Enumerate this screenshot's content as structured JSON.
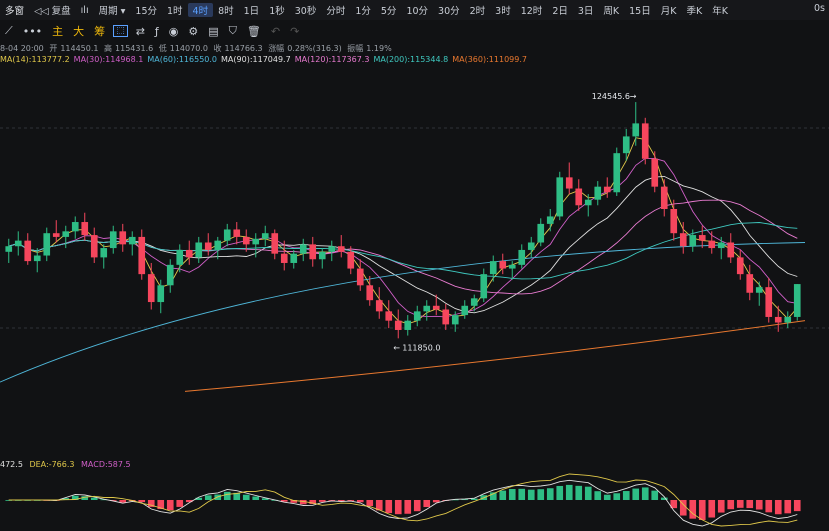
{
  "toolbar": {
    "left": "多窗",
    "replay": "复盘",
    "period": "周期",
    "items": [
      "15分",
      "1时",
      "4时",
      "8时",
      "1日",
      "1秒",
      "30秒",
      "分时",
      "1分",
      "5分",
      "10分",
      "30分",
      "2时",
      "3时",
      "12时",
      "2日",
      "3日",
      "周K",
      "15日",
      "月K",
      "季K",
      "年K"
    ],
    "active_index": 2,
    "right": "0s"
  },
  "drawbar": {
    "indicators": [
      "主",
      "大",
      "筹"
    ]
  },
  "ohlc": {
    "date": "8-04 20:00",
    "open_label": "开",
    "open": "114450.1",
    "high_label": "高",
    "high": "115431.6",
    "low_label": "低",
    "low": "114070.0",
    "close_label": "收",
    "close": "114766.3",
    "change_label": "涨幅",
    "change": "0.28%(316.3)",
    "amp_label": "振幅",
    "amp": "1.19%"
  },
  "ma": [
    {
      "label": "7",
      "value": "MA(14):113777.2",
      "color": "#e0c84a"
    },
    {
      "label": "ma30",
      "value": "MA(30):114968.1",
      "color": "#d05fc8"
    },
    {
      "label": "ma60",
      "value": "MA(60):116550.0",
      "color": "#4fb6d8"
    },
    {
      "label": "ma90",
      "value": "MA(90):117049.7",
      "color": "#e0e0e0"
    },
    {
      "label": "ma120",
      "value": "MA(120):117367.3",
      "color": "#e87bd0"
    },
    {
      "label": "ma200",
      "value": "MA(200):115344.8",
      "color": "#3fc9c0"
    },
    {
      "label": "ma360",
      "value": "MA(360):111099.7",
      "color": "#e8782f"
    }
  ],
  "macd": {
    "dif": "472.5",
    "dea": "DEA:-766.3",
    "macd": "MACD:587.5",
    "dif_color": "#e0e0e0",
    "dea_color": "#e0c84a",
    "macd_color": "#d05fc8"
  },
  "chart_data": {
    "type": "candlestick",
    "annotations": [
      {
        "text": "124545.6",
        "kind": "high"
      },
      {
        "text": "111850.0",
        "kind": "low"
      }
    ],
    "price_range": [
      108000,
      126000
    ],
    "candles": [
      [
        116500,
        117200,
        115900,
        116800
      ],
      [
        116800,
        117600,
        116300,
        117100
      ],
      [
        117100,
        117500,
        115800,
        116000
      ],
      [
        116000,
        116700,
        115400,
        116300
      ],
      [
        116300,
        117800,
        116000,
        117500
      ],
      [
        117500,
        118200,
        117000,
        117300
      ],
      [
        117300,
        117900,
        116700,
        117600
      ],
      [
        117600,
        118400,
        117200,
        118100
      ],
      [
        118100,
        118600,
        117100,
        117400
      ],
      [
        117400,
        117800,
        115900,
        116200
      ],
      [
        116200,
        116900,
        115600,
        116700
      ],
      [
        116700,
        117900,
        116400,
        117600
      ],
      [
        117600,
        118000,
        116500,
        116900
      ],
      [
        116900,
        117600,
        116300,
        117300
      ],
      [
        117300,
        117700,
        115000,
        115300
      ],
      [
        115300,
        115900,
        113400,
        113800
      ],
      [
        113800,
        115000,
        113200,
        114700
      ],
      [
        114700,
        116100,
        114300,
        115800
      ],
      [
        115800,
        116900,
        115400,
        116600
      ],
      [
        116600,
        117100,
        115800,
        116200
      ],
      [
        116200,
        117300,
        115900,
        117000
      ],
      [
        117000,
        117500,
        116300,
        116600
      ],
      [
        116600,
        117300,
        116100,
        117100
      ],
      [
        117100,
        118000,
        116800,
        117700
      ],
      [
        117700,
        118100,
        116900,
        117300
      ],
      [
        117300,
        117700,
        116500,
        116900
      ],
      [
        116900,
        117500,
        116200,
        117200
      ],
      [
        117200,
        117900,
        116800,
        117500
      ],
      [
        117500,
        117700,
        116100,
        116400
      ],
      [
        116400,
        117100,
        115500,
        115900
      ],
      [
        115900,
        116600,
        115600,
        116400
      ],
      [
        116400,
        117200,
        116000,
        116900
      ],
      [
        116900,
        117300,
        115700,
        116100
      ],
      [
        116100,
        116700,
        115600,
        116500
      ],
      [
        116500,
        117100,
        116000,
        116800
      ],
      [
        116800,
        117400,
        116200,
        116500
      ],
      [
        116500,
        116800,
        115300,
        115600
      ],
      [
        115600,
        116100,
        114400,
        114700
      ],
      [
        114700,
        115200,
        113600,
        113900
      ],
      [
        113900,
        114600,
        112900,
        113300
      ],
      [
        113300,
        113900,
        112400,
        112800
      ],
      [
        112800,
        113400,
        111850,
        112300
      ],
      [
        112300,
        113100,
        112000,
        112800
      ],
      [
        112800,
        113600,
        112500,
        113300
      ],
      [
        113300,
        113900,
        112800,
        113600
      ],
      [
        113600,
        114200,
        113100,
        113400
      ],
      [
        113400,
        113700,
        112300,
        112600
      ],
      [
        112600,
        113300,
        112200,
        113100
      ],
      [
        113100,
        113900,
        112900,
        113600
      ],
      [
        113600,
        114200,
        113300,
        114000
      ],
      [
        114000,
        115600,
        113800,
        115300
      ],
      [
        115300,
        116300,
        114900,
        116000
      ],
      [
        116000,
        116400,
        115300,
        115600
      ],
      [
        115600,
        116000,
        115000,
        115800
      ],
      [
        115800,
        116900,
        115600,
        116600
      ],
      [
        116600,
        117300,
        116200,
        117000
      ],
      [
        117000,
        118300,
        116800,
        118000
      ],
      [
        118000,
        118800,
        117600,
        118400
      ],
      [
        118400,
        120800,
        118200,
        120500
      ],
      [
        120500,
        121300,
        119600,
        119900
      ],
      [
        119900,
        120400,
        118700,
        119000
      ],
      [
        119000,
        119600,
        118400,
        119300
      ],
      [
        119300,
        120300,
        119000,
        120000
      ],
      [
        120000,
        120500,
        119400,
        119700
      ],
      [
        119700,
        122100,
        119500,
        121800
      ],
      [
        121800,
        123100,
        121400,
        122700
      ],
      [
        122700,
        124545.6,
        122200,
        123400
      ],
      [
        123400,
        123700,
        121200,
        121500
      ],
      [
        121500,
        121900,
        119700,
        120000
      ],
      [
        120000,
        120400,
        118400,
        118800
      ],
      [
        118800,
        119300,
        117100,
        117500
      ],
      [
        117500,
        118100,
        116400,
        116800
      ],
      [
        116800,
        117700,
        116500,
        117400
      ],
      [
        117400,
        117900,
        116700,
        117100
      ],
      [
        117100,
        117600,
        116400,
        116700
      ],
      [
        116700,
        117300,
        116100,
        117000
      ],
      [
        117000,
        117500,
        115900,
        116200
      ],
      [
        116200,
        116600,
        115000,
        115300
      ],
      [
        115300,
        115800,
        113900,
        114300
      ],
      [
        114300,
        114900,
        113600,
        114600
      ],
      [
        114600,
        115100,
        112700,
        113000
      ],
      [
        113000,
        113600,
        112200,
        112700
      ],
      [
        112700,
        113300,
        112400,
        113000
      ],
      [
        113000,
        114766.3,
        112800,
        114766.3
      ]
    ]
  }
}
